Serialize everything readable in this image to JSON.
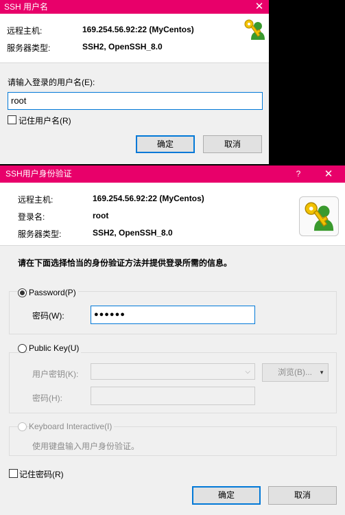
{
  "dialog1": {
    "title": "SSH 用户名",
    "close_glyph": "✕",
    "remote_host_label": "远程主机:",
    "remote_host_value": "169.254.56.92:22 (MyCentos)",
    "server_type_label": "服务器类型:",
    "server_type_value": "SSH2, OpenSSH_8.0",
    "username_prompt": "请输入登录的用户名(E):",
    "username_value": "root",
    "remember_username_label": "记住用户名(R)",
    "ok_label": "确定",
    "cancel_label": "取消"
  },
  "dialog2": {
    "title": "SSH用户身份验证",
    "help_glyph": "?",
    "close_glyph": "✕",
    "remote_host_label": "远程主机:",
    "remote_host_value": "169.254.56.92:22 (MyCentos)",
    "login_name_label": "登录名:",
    "login_name_value": "root",
    "server_type_label": "服务器类型:",
    "server_type_value": "SSH2, OpenSSH_8.0",
    "instruction": "请在下面选择恰当的身份验证方法并提供登录所需的信息。",
    "password_option": "Password(P)",
    "password_label": "密码(W):",
    "password_value": "●●●●●●",
    "publickey_option": "Public Key(U)",
    "user_key_label": "用户密钥(K):",
    "browse_label": "浏览(B)...",
    "passphrase_label": "密码(H):",
    "keyboard_option": "Keyboard Interactive(I)",
    "keyboard_desc": "使用键盘输入用户身份验证。",
    "remember_password_label": "记住密码(R)",
    "ok_label": "确定",
    "cancel_label": "取消"
  },
  "colors": {
    "titlebar": "#e8006a",
    "focus": "#0078d7"
  }
}
